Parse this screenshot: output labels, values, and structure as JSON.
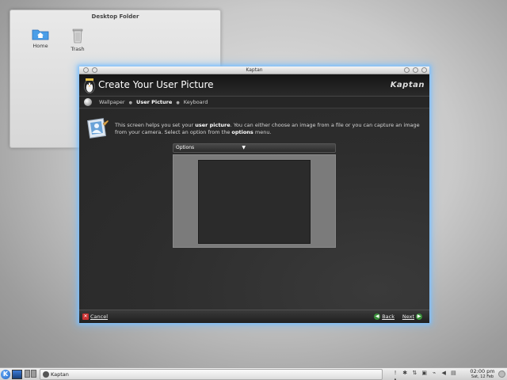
{
  "desktop_folder": {
    "title": "Desktop Folder",
    "icons": [
      {
        "label": "Home",
        "icon": "home-folder-icon"
      },
      {
        "label": "Trash",
        "icon": "trash-icon"
      }
    ]
  },
  "window": {
    "title": "Kaptan",
    "header_title": "Create Your User Picture",
    "logo_text": "Kaptan",
    "breadcrumb": {
      "items": [
        "Wallpaper",
        "User Picture",
        "Keyboard"
      ],
      "current_index": 1
    },
    "intro": {
      "part1": "This screen helps you set your ",
      "bold1": "user picture",
      "part2": ". You can either choose an image from a file or you can capture an image from your camera. Select an option from the ",
      "bold2": "options",
      "part3": " menu."
    },
    "options_label": "Options",
    "footer": {
      "cancel_label": "Cancel",
      "back_label": "Back",
      "next_label": "Next"
    }
  },
  "taskbar": {
    "task_label": "Kaptan",
    "clock_time": "02:00 pm",
    "clock_date": "Sat, 12 Feb"
  },
  "colors": {
    "glow": "#78beff",
    "window_bg": "#2d2d2d",
    "preview_frame": "#7b7b7b",
    "preview_area": "#2b2b2b"
  }
}
